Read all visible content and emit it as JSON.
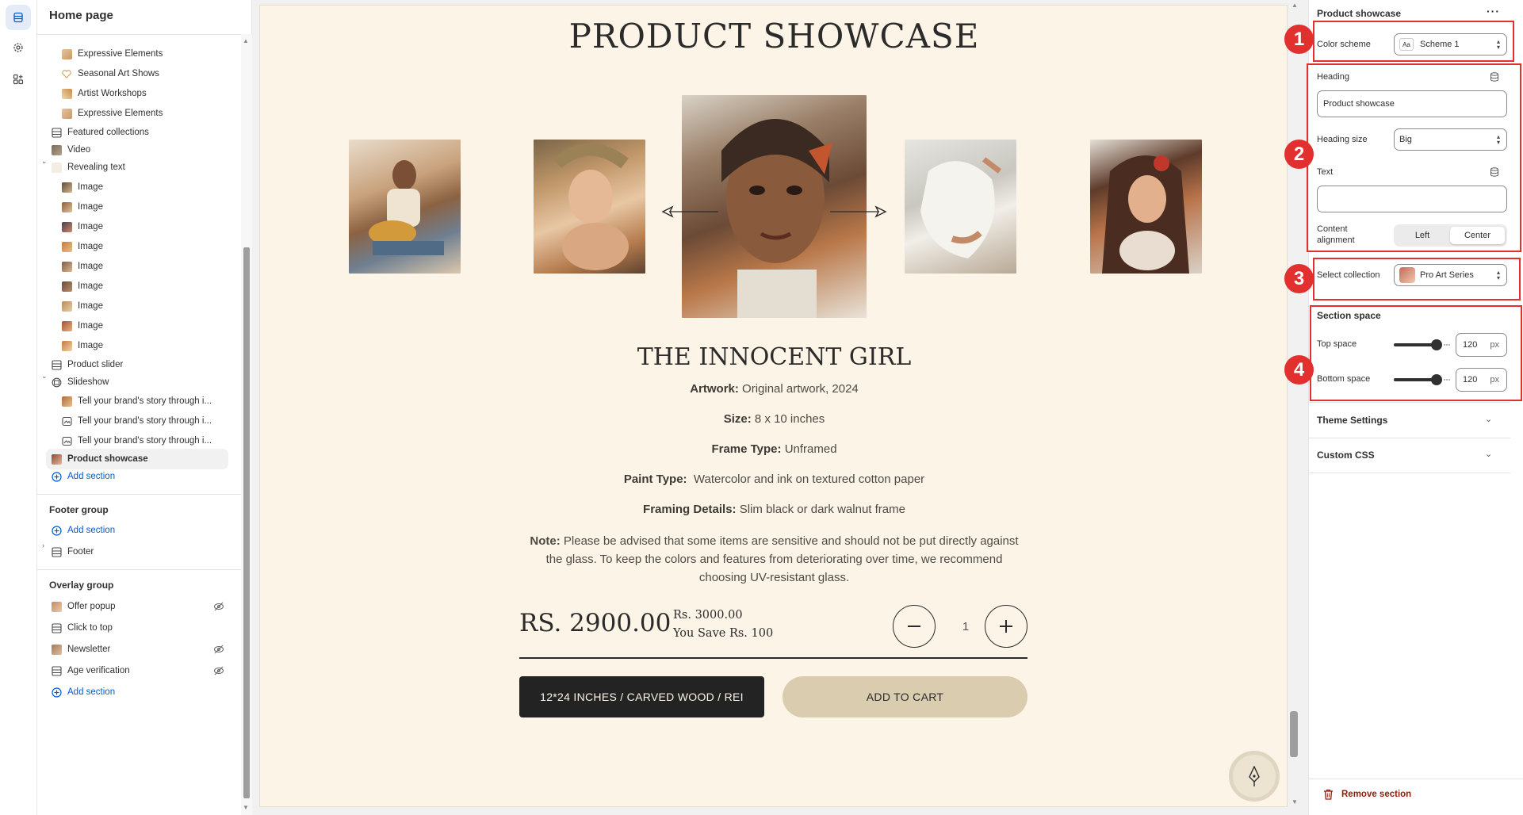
{
  "left_panel": {
    "title": "Home page",
    "items": [
      {
        "label": "Expressive Elements",
        "indent": 2
      },
      {
        "label": "Seasonal Art Shows",
        "indent": 2
      },
      {
        "label": "Artist Workshops",
        "indent": 2
      },
      {
        "label": "Expressive Elements",
        "indent": 2
      },
      {
        "label": "Featured collections",
        "indent": 1
      },
      {
        "label": "Video",
        "indent": 1
      },
      {
        "label": "Revealing text",
        "indent": 1
      },
      {
        "label": "Image",
        "indent": 2
      },
      {
        "label": "Image",
        "indent": 2
      },
      {
        "label": "Image",
        "indent": 2
      },
      {
        "label": "Image",
        "indent": 2
      },
      {
        "label": "Image",
        "indent": 2
      },
      {
        "label": "Image",
        "indent": 2
      },
      {
        "label": "Image",
        "indent": 2
      },
      {
        "label": "Image",
        "indent": 2
      },
      {
        "label": "Image",
        "indent": 2
      },
      {
        "label": "Product slider",
        "indent": 1
      },
      {
        "label": "Slideshow",
        "indent": 1
      },
      {
        "label": "Tell your brand's story through i...",
        "indent": 2
      },
      {
        "label": "Tell your brand's story through i...",
        "indent": 2
      },
      {
        "label": "Tell your brand's story through i...",
        "indent": 2
      },
      {
        "label": "Product showcase",
        "indent": 1,
        "selected": true
      }
    ],
    "add_section": "Add section",
    "footer_group": {
      "title": "Footer group",
      "add_section": "Add section",
      "footer": "Footer"
    },
    "overlay_group": {
      "title": "Overlay group",
      "items": [
        "Offer popup",
        "Click to top",
        "Newsletter",
        "Age verification"
      ],
      "add_section": "Add section"
    }
  },
  "preview": {
    "heading": "PRODUCT SHOWCASE",
    "product_title": "THE INNOCENT GIRL",
    "specs": [
      {
        "label": "Artwork:",
        "value": " Original artwork, 2024"
      },
      {
        "label": "Size:",
        "value": " 8 x 10 inches"
      },
      {
        "label": "Frame Type:",
        "value": " Unframed"
      },
      {
        "label": "Paint Type:",
        "value": "  Watercolor and ink on textured cotton paper"
      },
      {
        "label": "Framing Details:",
        "value": " Slim black or dark walnut frame"
      }
    ],
    "note_label": "Note:",
    "note_text": " Please be advised that some items are sensitive and should not be put directly against the glass. To keep the colors and features from deteriorating over time, we recommend choosing UV-resistant glass.",
    "price": "RS. 2900.00",
    "compare_price": "Rs. 3000.00",
    "savings": "You Save Rs. 100",
    "quantity": "1",
    "variant_label": "12*24 INCHES / CARVED WOOD / REI",
    "add_to_cart": "ADD TO CART"
  },
  "right_panel": {
    "title": "Product showcase",
    "color_scheme_label": "Color scheme",
    "color_scheme_value": "Scheme 1",
    "heading_label": "Heading",
    "heading_value": "Product showcase",
    "heading_size_label": "Heading size",
    "heading_size_value": "Big",
    "text_label": "Text",
    "text_value": "",
    "content_alignment_label": "Content alignment",
    "alignment_options": [
      "Left",
      "Center"
    ],
    "alignment_selected": "Center",
    "select_collection_label": "Select collection",
    "select_collection_value": "Pro Art Series",
    "section_space_title": "Section space",
    "top_space_label": "Top space",
    "top_space_value": "120",
    "bottom_space_label": "Bottom space",
    "bottom_space_value": "120",
    "unit": "px",
    "theme_settings": "Theme Settings",
    "custom_css": "Custom CSS",
    "remove_section": "Remove section"
  },
  "annotations": [
    "1",
    "2",
    "3",
    "4"
  ],
  "colors": {
    "accent_blue": "#005bd3",
    "annotation_red": "#e2302f",
    "preview_bg": "#fcf4e6",
    "cart_button": "#d9ccaf",
    "variant_button": "#232323",
    "remove_red": "#8e1f0b"
  }
}
